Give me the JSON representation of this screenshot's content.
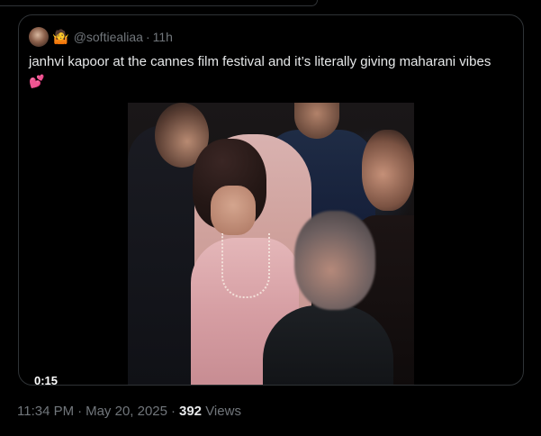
{
  "quoted_tweet": {
    "emoji_badge": "🤷",
    "handle": "@softiealiaa",
    "separator": "·",
    "time_ago": "11h",
    "text": "janhvi kapoor at the cannes film festival and it’s literally giving maharani vibes",
    "text_emoji": "💕",
    "video": {
      "duration": "0:15"
    }
  },
  "tweet_meta": {
    "time": "11:34 PM",
    "dot1": "·",
    "date": "May 20, 2025",
    "dot2": "·",
    "views_count": "392",
    "views_label": "Views"
  },
  "colors": {
    "background": "#000000",
    "border": "#2f3336",
    "primary_text": "#e7e9ea",
    "secondary_text": "#71767b"
  }
}
